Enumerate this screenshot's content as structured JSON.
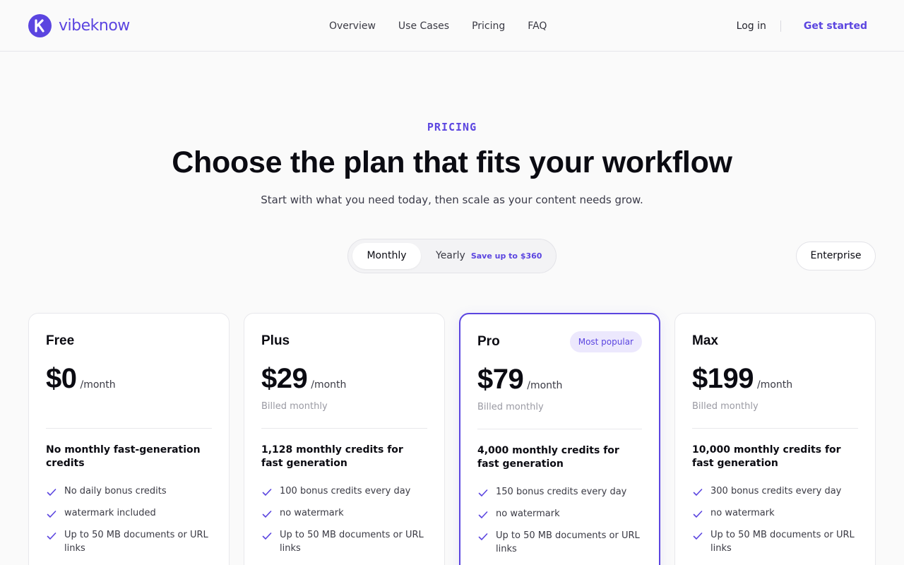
{
  "brand": {
    "name": "vibeknow",
    "accent": "#5b45e0"
  },
  "nav": {
    "links": [
      "Overview",
      "Use Cases",
      "Pricing",
      "FAQ"
    ],
    "login": "Log in",
    "get_started": "Get started"
  },
  "hero": {
    "eyebrow": "PRICING",
    "title": "Choose the plan that fits your workflow",
    "subtitle": "Start with what you need today, then scale as your content needs grow."
  },
  "billing_toggle": {
    "monthly": "Monthly",
    "yearly": "Yearly",
    "save_badge": "Save up to $360",
    "selected": "Monthly"
  },
  "enterprise_button": "Enterprise",
  "plans": [
    {
      "name": "Free",
      "price": "$0",
      "period": "/month",
      "billed": "",
      "credits": "No monthly fast-generation credits",
      "features": [
        "No daily bonus credits",
        "watermark included",
        "Up to 50 MB documents or URL links"
      ]
    },
    {
      "name": "Plus",
      "price": "$29",
      "period": "/month",
      "billed": "Billed monthly",
      "credits": "1,128 monthly credits for fast generation",
      "features": [
        "100 bonus credits every day",
        "no watermark",
        "Up to 50 MB documents or URL links"
      ]
    },
    {
      "name": "Pro",
      "badge": "Most popular",
      "price": "$79",
      "period": "/month",
      "billed": "Billed monthly",
      "credits": "4,000 monthly credits for fast generation",
      "features": [
        "150 bonus credits every day",
        "no watermark",
        "Up to 50 MB documents or URL links"
      ]
    },
    {
      "name": "Max",
      "price": "$199",
      "period": "/month",
      "billed": "Billed monthly",
      "credits": "10,000 monthly credits for fast generation",
      "features": [
        "300 bonus credits every day",
        "no watermark",
        "Up to 50 MB documents or URL links"
      ]
    }
  ]
}
